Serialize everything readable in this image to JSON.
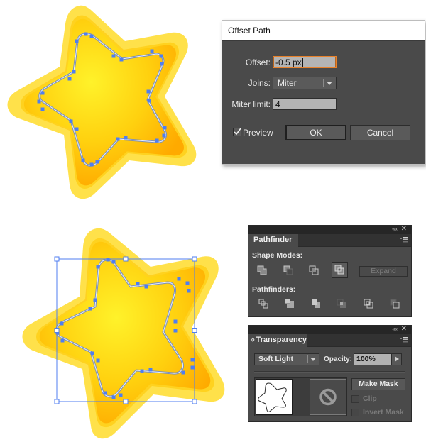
{
  "colors": {
    "star_outer": "#ffe14a",
    "star_mid": "#ffd21f",
    "star_inner_center": "#fff22a",
    "star_inner_edge": "#ffaa00",
    "selection_blue": "#4f7ef0",
    "dialog_bg": "#4a4a4a",
    "focus_orange": "#e8812a"
  },
  "offset_dialog": {
    "title": "Offset Path",
    "offset_label": "Offset:",
    "offset_value": "-0.5 px",
    "joins_label": "Joins:",
    "joins_value": "Miter",
    "miter_label": "Miter limit:",
    "miter_value": "4",
    "preview_label": "Preview",
    "preview_checked": true,
    "ok_label": "OK",
    "cancel_label": "Cancel"
  },
  "pathfinder_panel": {
    "tab_label": "Pathfinder",
    "collapse_icon": "««",
    "close_icon": "✕",
    "shape_modes_label": "Shape Modes:",
    "shape_modes": [
      "unite",
      "minus-front",
      "intersect",
      "exclude"
    ],
    "active_shape_mode": "exclude",
    "expand_label": "Expand",
    "pathfinders_label": "Pathfinders:",
    "pathfinders": [
      "divide",
      "trim",
      "merge",
      "crop",
      "outline",
      "minus-back"
    ]
  },
  "transparency_panel": {
    "tab_label": "Transparency",
    "tab_icon": "◊",
    "collapse_icon": "««",
    "close_icon": "✕",
    "blend_mode": "Soft Light",
    "opacity_label": "Opacity:",
    "opacity_value": "100%",
    "make_mask_label": "Make Mask",
    "clip_label": "Clip",
    "invert_mask_label": "Invert Mask"
  }
}
